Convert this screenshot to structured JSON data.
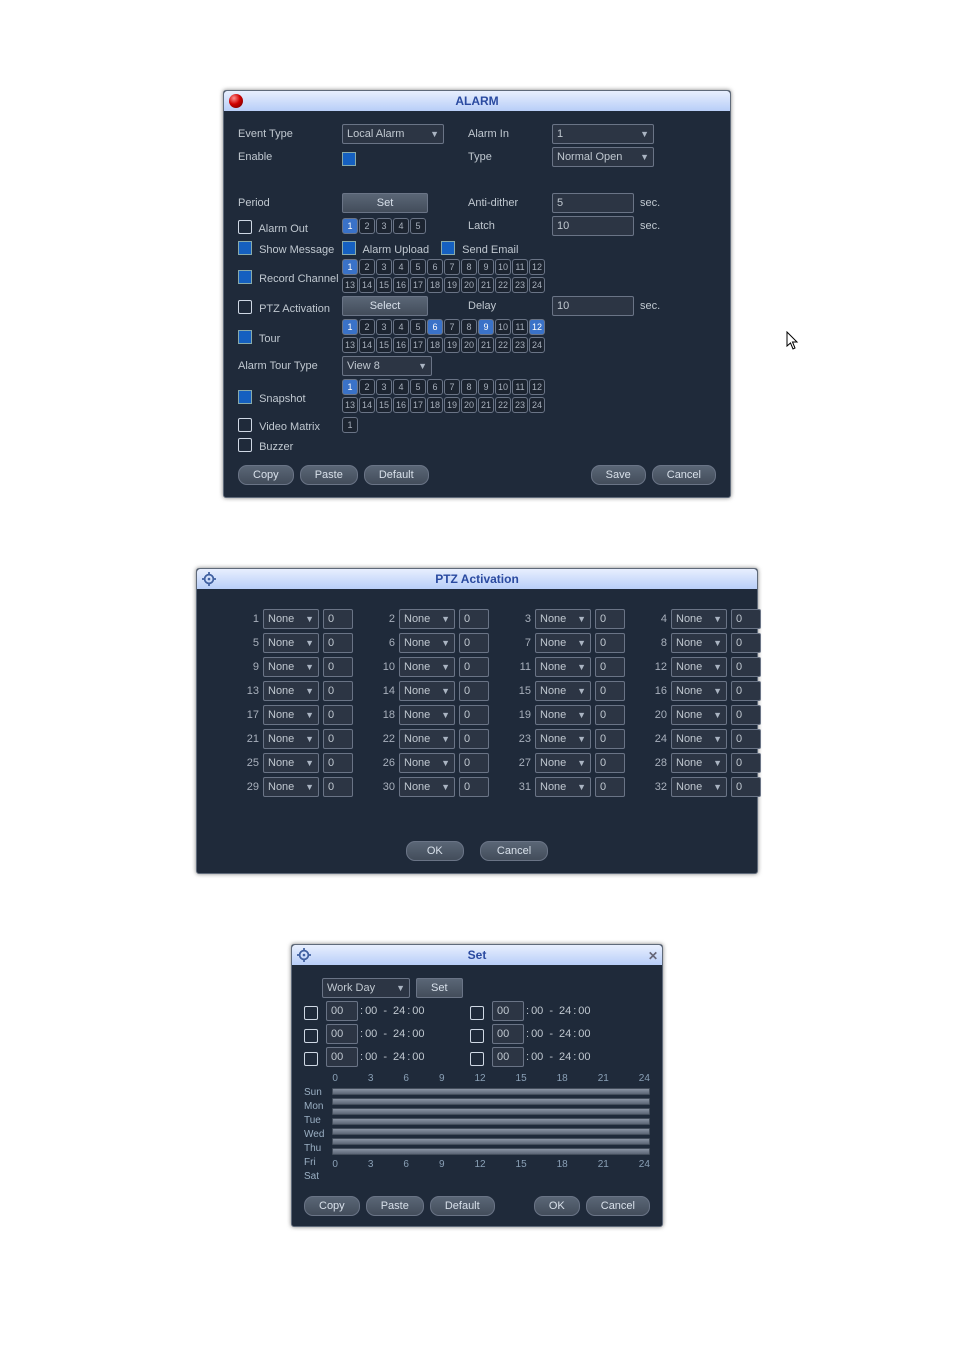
{
  "alarm": {
    "title": "ALARM",
    "cursor": true,
    "labels": {
      "event_type": "Event Type",
      "enable": "Enable",
      "alarm_in": "Alarm In",
      "type": "Type",
      "period": "Period",
      "anti_dither": "Anti-dither",
      "alarm_out": "Alarm Out",
      "latch": "Latch",
      "show_message": "Show Message",
      "alarm_upload": "Alarm Upload",
      "send_email": "Send Email",
      "record_channel": "Record Channel",
      "ptz_activation": "PTZ Activation",
      "delay": "Delay",
      "tour": "Tour",
      "alarm_tour_type": "Alarm Tour Type",
      "snapshot": "Snapshot",
      "video_matrix": "Video Matrix",
      "buzzer": "Buzzer",
      "set": "Set",
      "select": "Select",
      "sec": "sec."
    },
    "values": {
      "event_type": "Local Alarm",
      "alarm_in": "1",
      "type": "Normal Open",
      "anti_dither": "5",
      "latch": "10",
      "delay": "10",
      "tour_type": "View 8"
    },
    "alarm_out_on": [
      1
    ],
    "record_on": [
      1
    ],
    "tour_on": [
      1,
      6,
      9,
      12
    ],
    "snapshot_on": [
      1
    ],
    "matrix_channels": [
      1
    ],
    "footer": {
      "copy": "Copy",
      "paste": "Paste",
      "default": "Default",
      "save": "Save",
      "cancel": "Cancel"
    }
  },
  "ptz": {
    "title": "PTZ Activation",
    "count": 32,
    "option": "None",
    "value": "0",
    "ok": "OK",
    "cancel": "Cancel"
  },
  "set": {
    "title": "Set",
    "day_select": "Work Day",
    "set_btn": "Set",
    "periods": [
      {
        "t1": "00",
        "t2": "00",
        "t3": "24",
        "t4": "00",
        "t5": "00",
        "t6": "00",
        "t7": "24",
        "t8": "00"
      },
      {
        "t1": "00",
        "t2": "00",
        "t3": "24",
        "t4": "00",
        "t5": "00",
        "t6": "00",
        "t7": "24",
        "t8": "00"
      },
      {
        "t1": "00",
        "t2": "00",
        "t3": "24",
        "t4": "00",
        "t5": "00",
        "t6": "00",
        "t7": "24",
        "t8": "00"
      }
    ],
    "days": [
      "Sun",
      "Mon",
      "Tue",
      "Wed",
      "Thu",
      "Fri",
      "Sat"
    ],
    "ticks": [
      "0",
      "3",
      "6",
      "9",
      "12",
      "15",
      "18",
      "21",
      "24"
    ],
    "footer": {
      "copy": "Copy",
      "paste": "Paste",
      "default": "Default",
      "ok": "OK",
      "cancel": "Cancel"
    }
  }
}
